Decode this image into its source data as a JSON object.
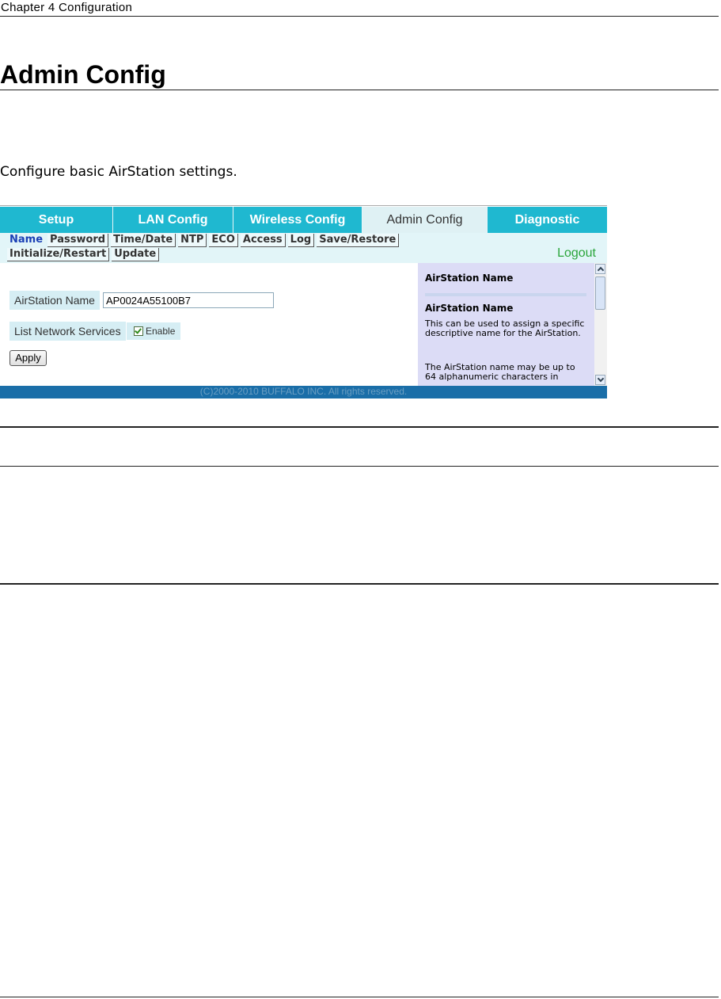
{
  "doc": {
    "chapter_header": "Chapter 4  Configuration",
    "title": "Admin Config",
    "intro": "Configure basic AirStation settings."
  },
  "ui": {
    "tabs": [
      {
        "label": "Setup"
      },
      {
        "label": "LAN Config"
      },
      {
        "label": "Wireless Config"
      },
      {
        "label": "Admin Config"
      },
      {
        "label": "Diagnostic"
      }
    ],
    "subnav_row1": [
      "Name",
      "Password",
      "Time/Date",
      "NTP",
      "ECO",
      "Access",
      "Log",
      "Save/Restore"
    ],
    "subnav_row2": [
      "Initialize/Restart",
      "Update"
    ],
    "logout": "Logout",
    "form": {
      "airstation_name_label": "AirStation Name",
      "airstation_name_value": "AP0024A55100B7",
      "list_services_label": "List Network Services",
      "enable_label": "Enable",
      "apply_label": "Apply"
    },
    "help": {
      "heading": "AirStation Name",
      "subheading": "AirStation Name",
      "para1": "This can be used to assign a specific descriptive name for the AirStation.",
      "para2": "The AirStation name may be up to 64 alphanumeric characters in"
    },
    "footer": "(C)2000-2010 BUFFALO INC. All rights reserved."
  }
}
